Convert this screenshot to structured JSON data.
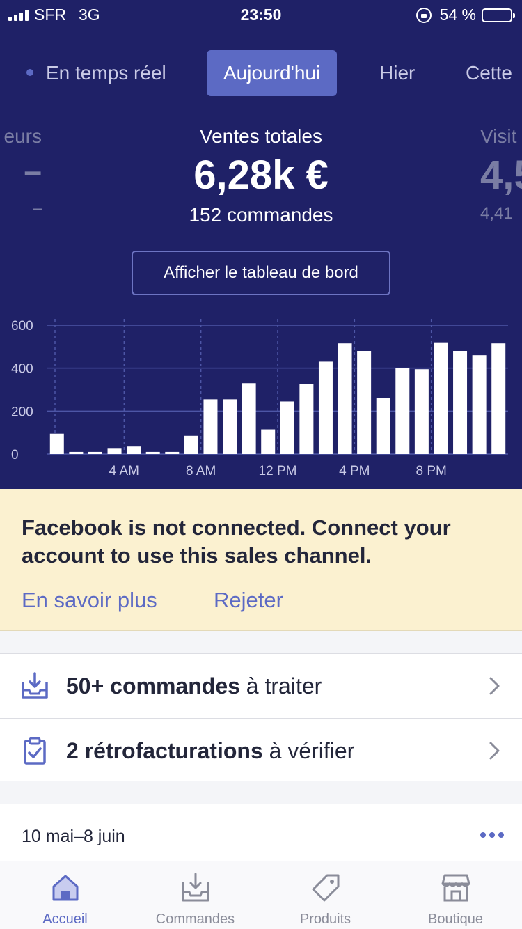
{
  "status_bar": {
    "carrier": "SFR",
    "network": "3G",
    "time": "23:50",
    "battery": "54 %",
    "battery_level": 0.54
  },
  "period_tabs": {
    "realtime": "En temps réel",
    "today": "Aujourd'hui",
    "yesterday": "Hier",
    "this_partial": "Cette"
  },
  "metrics": {
    "left": {
      "label": "eurs",
      "value": "–",
      "sub": "–"
    },
    "center": {
      "label": "Ventes totales",
      "value": "6,28k €",
      "sub": "152 commandes"
    },
    "right": {
      "label": "Visit",
      "value": "4,5",
      "sub": "4,41"
    }
  },
  "dashboard_button": "Afficher le tableau de bord",
  "chart_data": {
    "type": "bar",
    "categories": [
      "0",
      "1",
      "2",
      "3",
      "4",
      "5",
      "6",
      "7",
      "8",
      "9",
      "10",
      "11",
      "12",
      "13",
      "14",
      "15",
      "16",
      "17",
      "18",
      "19",
      "20",
      "21",
      "22",
      "23"
    ],
    "values": [
      95,
      10,
      10,
      25,
      35,
      10,
      10,
      85,
      255,
      255,
      330,
      115,
      245,
      325,
      430,
      515,
      480,
      260,
      400,
      395,
      520,
      480,
      460,
      515
    ],
    "tick_labels": [
      "4 AM",
      "8 AM",
      "12 PM",
      "4 PM",
      "8 PM"
    ],
    "tick_indices": [
      4,
      8,
      12,
      16,
      20
    ],
    "y_ticks": [
      "0",
      "200",
      "400",
      "600"
    ],
    "ylim": [
      0,
      600
    ],
    "grid": true,
    "title": "",
    "xlabel": "",
    "ylabel": ""
  },
  "banner": {
    "message": "Facebook is not connected. Connect your account to use this sales channel.",
    "learn_more": "En savoir plus",
    "dismiss": "Rejeter"
  },
  "tasks": [
    {
      "strong": "50+ commandes",
      "rest": " à traiter",
      "icon": "inbox-download-icon"
    },
    {
      "strong": "2 rétrofacturations",
      "rest": " à vérifier",
      "icon": "clipboard-check-icon"
    }
  ],
  "card": {
    "date": "10 mai–8 juin"
  },
  "tab_bar": [
    {
      "label": "Accueil",
      "icon": "home-icon",
      "active": true
    },
    {
      "label": "Commandes",
      "icon": "orders-icon",
      "active": false
    },
    {
      "label": "Produits",
      "icon": "tag-icon",
      "active": false
    },
    {
      "label": "Boutique",
      "icon": "store-icon",
      "active": false
    }
  ],
  "colors": {
    "hero": "#1f2167",
    "accent": "#5c6ac4",
    "banner": "#fbf1d0"
  }
}
